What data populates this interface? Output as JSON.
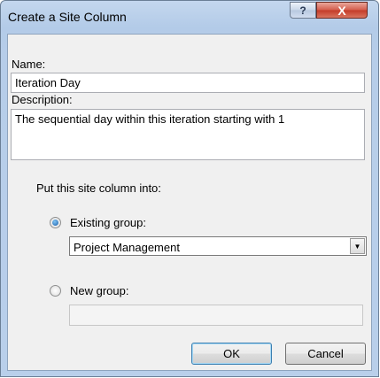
{
  "window": {
    "title": "Create a Site Column",
    "help_glyph": "?",
    "close_glyph": "X"
  },
  "form": {
    "name_label": "Name:",
    "name_value": "Iteration Day",
    "description_label": "Description:",
    "description_value": "The sequential day within this iteration starting with 1",
    "put_into_label": "Put this site column into:",
    "existing_group_label": "Existing group:",
    "existing_group_selected": true,
    "existing_group_value": "Project Management",
    "new_group_label": "New group:",
    "new_group_value": ""
  },
  "buttons": {
    "ok": "OK",
    "cancel": "Cancel"
  },
  "icons": {
    "dropdown_arrow": "▼"
  }
}
